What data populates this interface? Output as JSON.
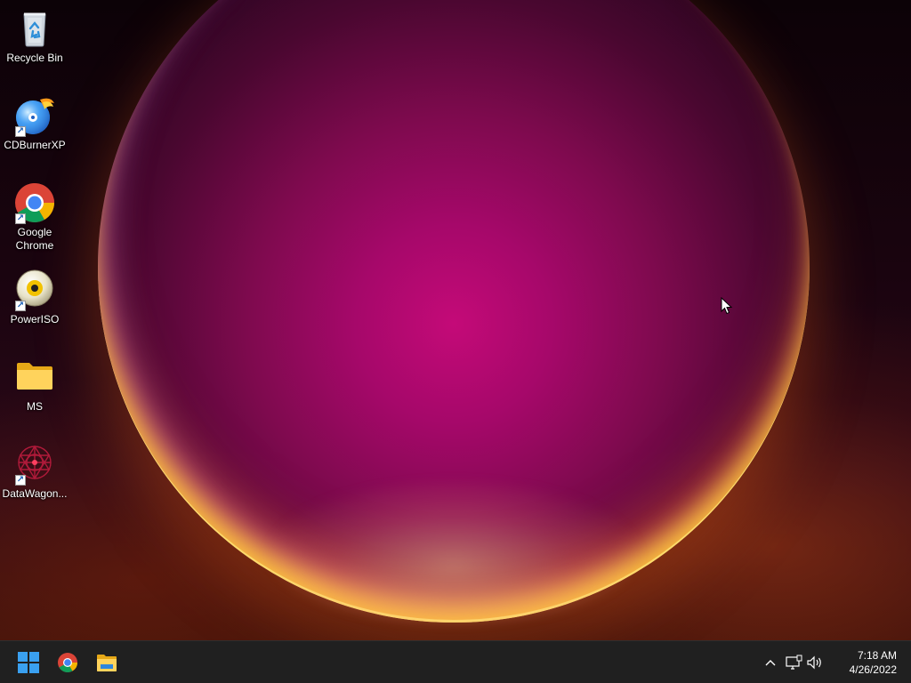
{
  "desktop": {
    "icons": [
      {
        "label": "Recycle Bin",
        "icon": "recycle-bin-icon"
      },
      {
        "label": "CDBurnerXP",
        "icon": "cdburnerxp-icon",
        "shortcut": true
      },
      {
        "label": "Google Chrome",
        "icon": "chrome-icon",
        "shortcut": true
      },
      {
        "label": "PowerISO",
        "icon": "poweriso-icon",
        "shortcut": true
      },
      {
        "label": "MS",
        "icon": "folder-icon"
      },
      {
        "label": "DataWagon...",
        "icon": "datawagon-icon",
        "shortcut": true
      }
    ]
  },
  "taskbar": {
    "pinned": [
      {
        "icon": "windows-start-icon"
      },
      {
        "icon": "chrome-icon"
      },
      {
        "icon": "file-explorer-icon"
      }
    ],
    "tray": {
      "icons": [
        "chevron-up-icon",
        "network-icon",
        "volume-icon"
      ],
      "time": "7:18 AM",
      "date": "4/26/2022"
    }
  },
  "colors": {
    "taskbar_bg": "#202020",
    "wallpaper_accent": "#c40a78",
    "wallpaper_rim": "#ffd23c"
  }
}
